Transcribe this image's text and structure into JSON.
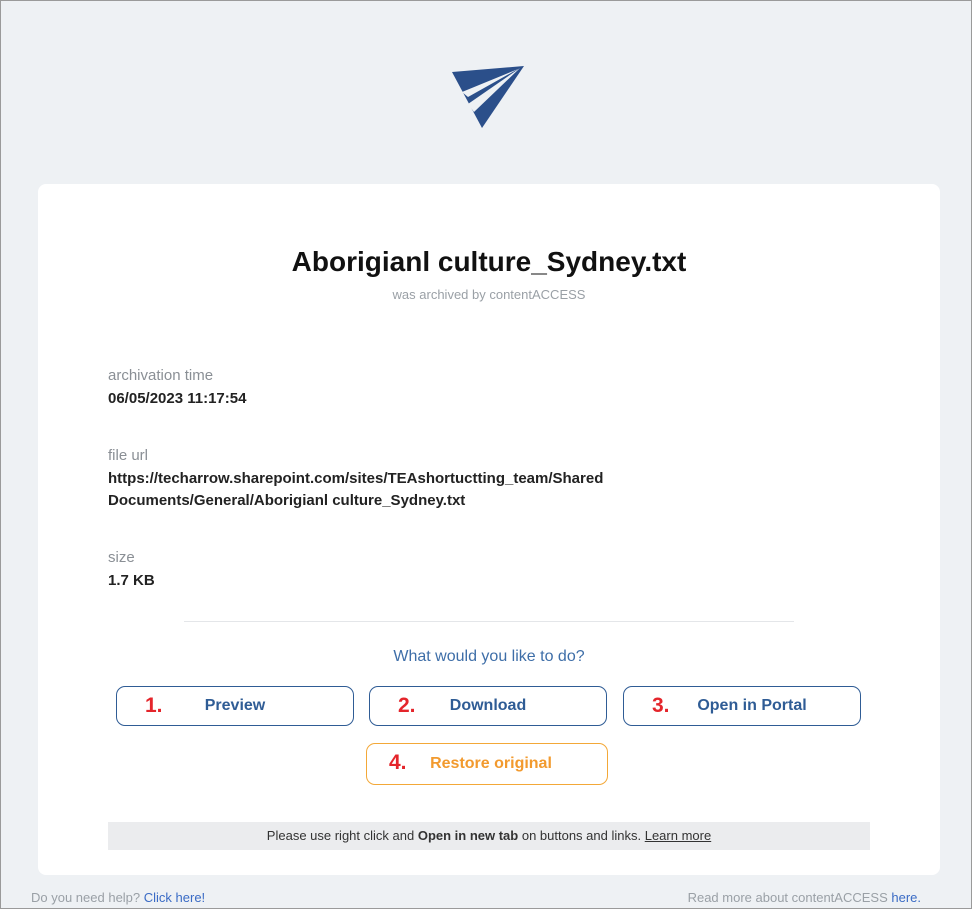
{
  "file": {
    "name": "Aborigianl culture_Sydney.txt",
    "archived_by": "was archived by contentACCESS"
  },
  "fields": {
    "archivation_time_label": "archivation time",
    "archivation_time_value": "06/05/2023 11:17:54",
    "file_url_label": "file url",
    "file_url_line1": "https://techarrow.sharepoint.com/sites/TEAshortuctting_team/Shared",
    "file_url_line2": "Documents/General/Aborigianl culture_Sydney.txt",
    "size_label": "size",
    "size_value": "1.7 KB"
  },
  "actions": {
    "question": "What would you like to do?",
    "preview": {
      "num": "1.",
      "label": "Preview"
    },
    "download": {
      "num": "2.",
      "label": "Download"
    },
    "open_portal": {
      "num": "3.",
      "label": "Open in Portal"
    },
    "restore": {
      "num": "4.",
      "label": "Restore original"
    }
  },
  "notice": {
    "prefix": "Please use right click and ",
    "bold": "Open in new tab",
    "suffix": " on buttons and links. ",
    "link": "Learn more"
  },
  "footer": {
    "help_text": "Do you need help? ",
    "help_link": "Click here!",
    "read_text": "Read more about contentACCESS ",
    "read_link": "here."
  },
  "colors": {
    "accent": "#2f5c95",
    "logo": "#2b4f8a",
    "number": "#e4252b",
    "restore": "#f29a2e"
  },
  "icons": {
    "logo": "paper-plane-logo"
  }
}
